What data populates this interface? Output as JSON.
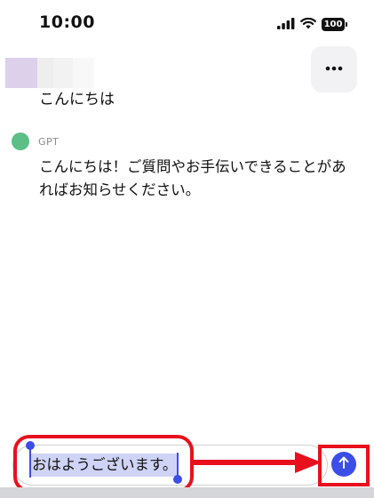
{
  "status_bar": {
    "time": "10:00",
    "battery": "100"
  },
  "conversation": {
    "user_message": "こんにちは",
    "assistant_name": "GPT",
    "assistant_message": "こんにちは！ご質問やお手伝いできることがあればお知らせください。"
  },
  "composer": {
    "input_value": "おはようございます。",
    "send_icon": "arrow-up-icon"
  },
  "header": {
    "menu_icon": "more-horizontal-icon"
  },
  "colors": {
    "accent": "#3b4ee8",
    "assistant_avatar": "#5bbf86",
    "selection": "#cfd3f5",
    "annotation": "#e8101d"
  }
}
